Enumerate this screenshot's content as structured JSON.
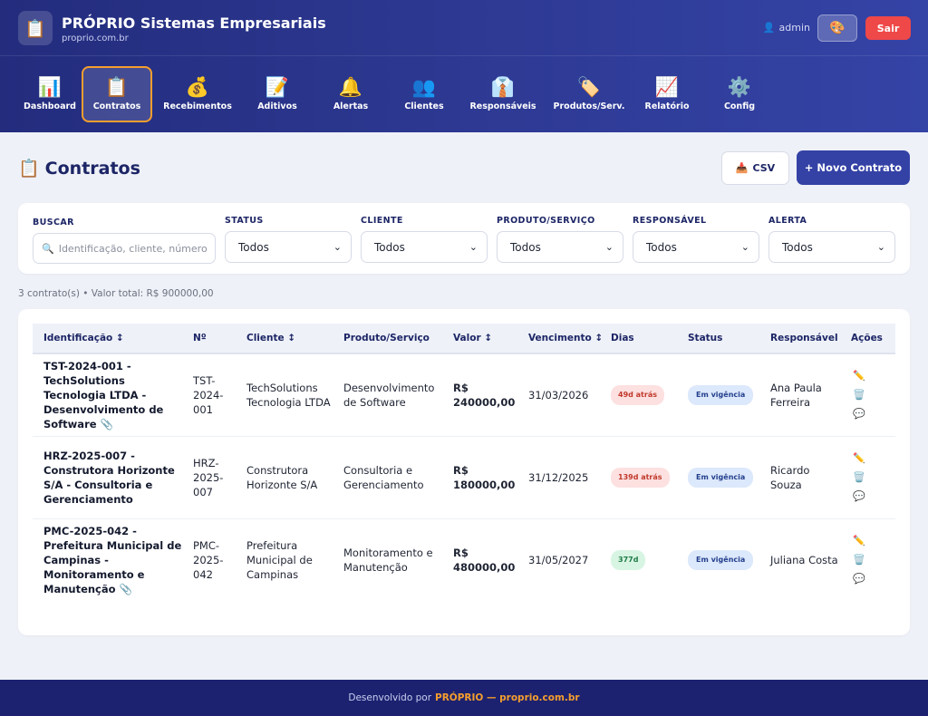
{
  "header": {
    "brand_title": "PRÓPRIO Sistemas Empresariais",
    "brand_subtitle": "proprio.com.br",
    "logo_icon": "clipboard-icon",
    "user_name": "admin",
    "theme_icon": "palette-icon",
    "logout_label": "Sair"
  },
  "nav": {
    "items": [
      {
        "icon": "📊",
        "label": "Dashboard"
      },
      {
        "icon": "📋",
        "label": "Contratos",
        "active": true
      },
      {
        "icon": "💰",
        "label": "Recebimentos"
      },
      {
        "icon": "📝",
        "label": "Aditivos"
      },
      {
        "icon": "🔔",
        "label": "Alertas"
      },
      {
        "icon": "👥",
        "label": "Clientes"
      },
      {
        "icon": "👔",
        "label": "Responsáveis"
      },
      {
        "icon": "🏷️",
        "label": "Produtos/Serv."
      },
      {
        "icon": "📈",
        "label": "Relatório"
      },
      {
        "icon": "⚙️",
        "label": "Config"
      }
    ]
  },
  "page": {
    "title": "Contratos",
    "csv_label": "CSV",
    "new_label": "+ Novo Contrato"
  },
  "filters": {
    "search_label": "BUSCAR",
    "search_placeholder": "Identificação, cliente, número...",
    "status_label": "STATUS",
    "status_value": "Todos",
    "cliente_label": "CLIENTE",
    "cliente_value": "Todos",
    "produto_label": "PRODUTO/SERVIÇO",
    "produto_value": "Todos",
    "responsavel_label": "RESPONSÁVEL",
    "responsavel_value": "Todos",
    "alerta_label": "ALERTA",
    "alerta_value": "Todos"
  },
  "summary": "3 contrato(s) • Valor total: R$ 900000,00",
  "table": {
    "columns": {
      "identificacao": "Identificação ↕",
      "numero": "Nº",
      "cliente": "Cliente ↕",
      "produto": "Produto/Serviço",
      "valor": "Valor ↕",
      "vencimento": "Vencimento ↕",
      "dias": "Dias",
      "status": "Status",
      "responsavel": "Responsável",
      "acoes": "Ações"
    },
    "rows": [
      {
        "identificacao": "TST-2024-001 - TechSolutions Tecnologia LTDA - Desenvolvimento de Software",
        "has_attachment": true,
        "numero": "TST-2024-001",
        "cliente": "TechSolutions Tecnologia LTDA",
        "produto": "Desenvolvimento de Software",
        "valor": "R$ 240000,00",
        "vencimento": "31/03/2026",
        "dias": "49d atrás",
        "dias_type": "red",
        "status": "Em vigência",
        "responsavel": "Ana Paula Ferreira"
      },
      {
        "identificacao": "HRZ-2025-007 - Construtora Horizonte S/A - Consultoria e Gerenciamento",
        "has_attachment": false,
        "numero": "HRZ-2025-007",
        "cliente": "Construtora Horizonte S/A",
        "produto": "Consultoria e Gerenciamento",
        "valor": "R$ 180000,00",
        "vencimento": "31/12/2025",
        "dias": "139d atrás",
        "dias_type": "red",
        "status": "Em vigência",
        "responsavel": "Ricardo Souza"
      },
      {
        "identificacao": "PMC-2025-042 - Prefeitura Municipal de Campinas - Monitoramento e Manutenção",
        "has_attachment": true,
        "numero": "PMC-2025-042",
        "cliente": "Prefeitura Municipal de Campinas",
        "produto": "Monitoramento e Manutenção",
        "valor": "R$ 480000,00",
        "vencimento": "31/05/2027",
        "dias": "377d",
        "dias_type": "green",
        "status": "Em vigência",
        "responsavel": "Juliana Costa"
      }
    ]
  },
  "footer": {
    "prefix": "Desenvolvido por",
    "brand": "PRÓPRIO — proprio.com.br"
  },
  "colors": {
    "header": "#2e3a94",
    "accent_orange": "#f59e2e",
    "logout_red": "#ee4848",
    "primary_button": "#3442a6",
    "footer": "#1c2270"
  }
}
